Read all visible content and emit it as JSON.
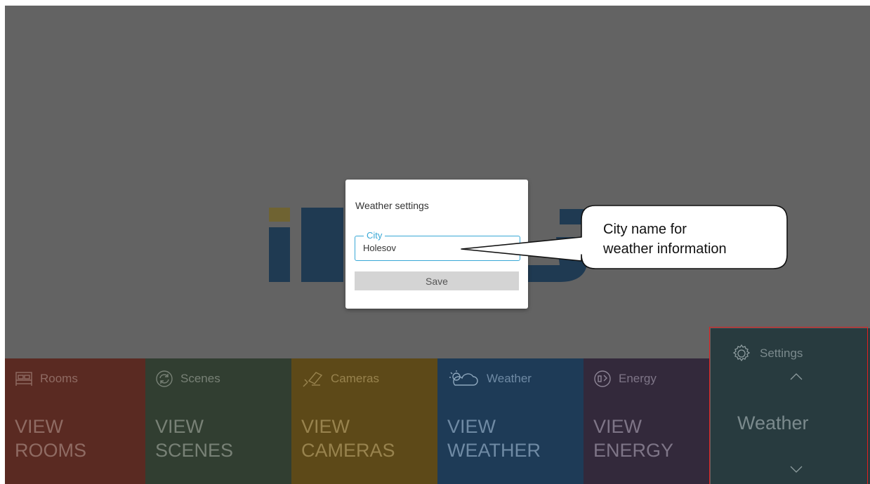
{
  "tiles": [
    {
      "key": "rooms",
      "header": "Rooms",
      "line1": "VIEW",
      "line2": "ROOMS",
      "icon": "bed-icon"
    },
    {
      "key": "scenes",
      "header": "Scenes",
      "line1": "VIEW",
      "line2": "SCENES",
      "icon": "refresh-icon"
    },
    {
      "key": "cameras",
      "header": "Cameras",
      "line1": "VIEW",
      "line2": "CAMERAS",
      "icon": "camera-icon"
    },
    {
      "key": "weather",
      "header": "Weather",
      "line1": "VIEW",
      "line2": "WEATHER",
      "icon": "cloud-sun-icon"
    },
    {
      "key": "energy",
      "header": "Energy",
      "line1": "VIEW",
      "line2": "ENERGY",
      "icon": "gauge-icon"
    }
  ],
  "settings_panel": {
    "header": "Settings",
    "value": "Weather",
    "icon": "gear-icon"
  },
  "dialog": {
    "title": "Weather settings",
    "city_label": "City",
    "city_value": "Holesov",
    "save_label": "Save"
  },
  "callout": {
    "line1": "City name for",
    "line2": "weather information"
  },
  "colors": {
    "overlay": "#636363",
    "rooms": "#5a2a22",
    "scenes": "#313e31",
    "cameras": "#5d4918",
    "weather": "#1e3b57",
    "energy": "#33293b",
    "settings": "#283b3f",
    "accent": "#38a8d6",
    "highlight": "#e02020"
  }
}
